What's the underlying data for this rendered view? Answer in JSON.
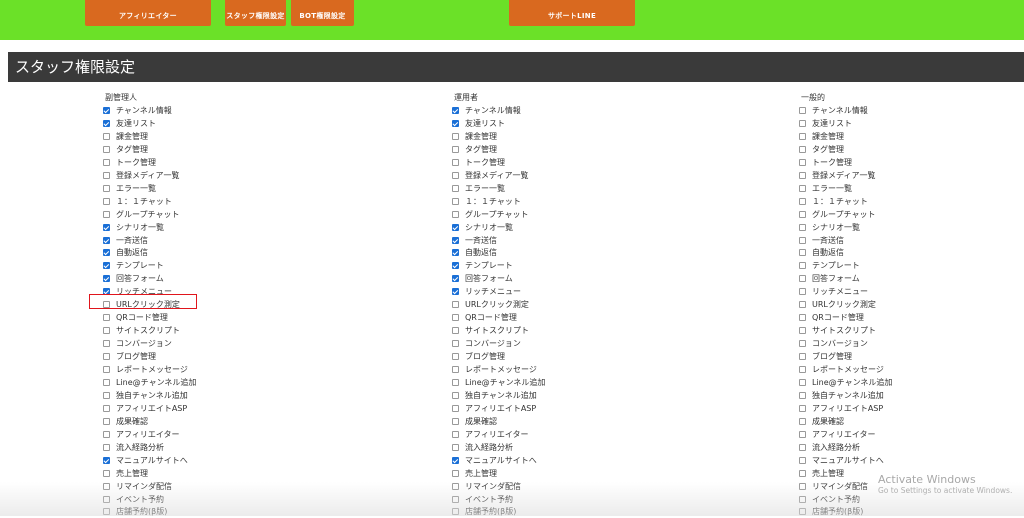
{
  "top_buttons": [
    "アフィリエイター",
    "スタッフ権限設定",
    "BOT権限設定",
    "サポートLINE"
  ],
  "section_title": "スタッフ権限設定",
  "columns": [
    {
      "header": "副管理人",
      "checked": [
        1,
        1,
        0,
        0,
        0,
        0,
        0,
        0,
        0,
        1,
        1,
        1,
        1,
        1,
        1,
        0,
        0,
        0,
        0,
        0,
        0,
        0,
        0,
        0,
        0,
        0,
        0,
        1,
        0,
        0,
        0,
        0
      ]
    },
    {
      "header": "運用者",
      "checked": [
        1,
        1,
        0,
        0,
        0,
        0,
        0,
        0,
        0,
        1,
        1,
        1,
        1,
        1,
        1,
        0,
        0,
        0,
        0,
        0,
        0,
        0,
        0,
        0,
        0,
        0,
        0,
        1,
        0,
        0,
        0,
        0
      ]
    },
    {
      "header": "一般的",
      "checked": [
        0,
        0,
        0,
        0,
        0,
        0,
        0,
        0,
        0,
        0,
        0,
        0,
        0,
        0,
        0,
        0,
        0,
        0,
        0,
        0,
        0,
        0,
        0,
        0,
        0,
        0,
        0,
        0,
        0,
        0,
        0,
        0
      ]
    }
  ],
  "permissions": [
    "チャンネル情報",
    "友達リスト",
    "課金管理",
    "タグ管理",
    "トーク管理",
    "登録メディア一覧",
    "エラー一覧",
    "１：１チャット",
    "グループチャット",
    "シナリオ一覧",
    "一斉送信",
    "自動返信",
    "テンプレート",
    "回答フォーム",
    "リッチメニュー",
    "URLクリック測定",
    "QRコード管理",
    "サイトスクリプト",
    "コンバージョン",
    "ブログ管理",
    "レポートメッセージ",
    "Line@チャンネル追加",
    "独自チャンネル追加",
    "アフィリエイトASP",
    "成果確認",
    "アフィリエイター",
    "流入経路分析",
    "マニュアルサイトへ",
    "売上管理",
    "リマインダ配信",
    "イベント予約",
    "店舗予約(β版)"
  ],
  "watermark": {
    "line1": "Activate Windows",
    "line2": "Go to Settings to activate Windows."
  }
}
